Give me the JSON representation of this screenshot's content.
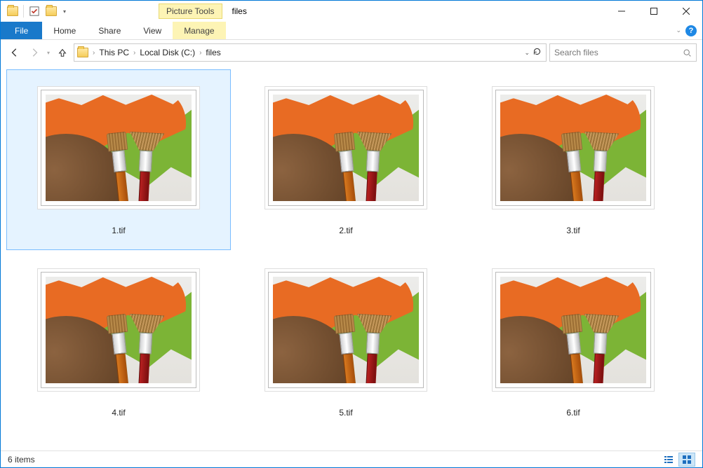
{
  "window": {
    "context_tools_label": "Picture Tools",
    "title": "files"
  },
  "ribbon": {
    "file": "File",
    "tabs": [
      "Home",
      "Share",
      "View"
    ],
    "contextual": "Manage"
  },
  "breadcrumb": {
    "segments": [
      "This PC",
      "Local Disk (C:)",
      "files"
    ]
  },
  "search": {
    "placeholder": "Search files"
  },
  "items": [
    {
      "name": "1.tif",
      "selected": true
    },
    {
      "name": "2.tif",
      "selected": false
    },
    {
      "name": "3.tif",
      "selected": false
    },
    {
      "name": "4.tif",
      "selected": false
    },
    {
      "name": "5.tif",
      "selected": false
    },
    {
      "name": "6.tif",
      "selected": false
    }
  ],
  "status": {
    "count_label": "6 items"
  }
}
